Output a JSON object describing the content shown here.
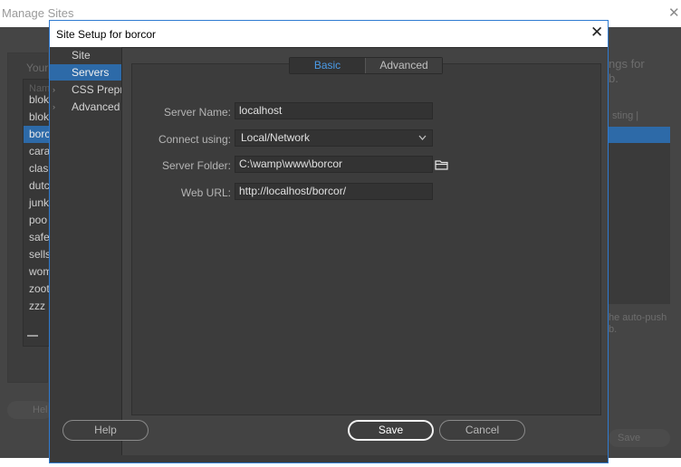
{
  "background_window": {
    "title": "Manage Sites",
    "close_glyph": "✕",
    "your_sites_label": "Your",
    "list_header": "Nam",
    "sites": [
      "blok",
      "blok",
      "borc",
      "cara",
      "clas",
      "dutc",
      "junk",
      "poo",
      "safe",
      "sells",
      "wom",
      "zoot",
      "zzz"
    ],
    "selected_site_index": 2,
    "help_label": "Hel",
    "right_text_1": "ngs for\nb.",
    "right_text_2": "sting  |",
    "right_text_3": "he auto-push\nb.",
    "save_label": "Save"
  },
  "dialog": {
    "title": "Site Setup for borcor",
    "close_glyph": "✕",
    "categories": [
      {
        "label": "Site",
        "has_arrow": false,
        "selected": false
      },
      {
        "label": "Servers",
        "has_arrow": false,
        "selected": true
      },
      {
        "label": "CSS Preprocessors",
        "has_arrow": true,
        "selected": false
      },
      {
        "label": "Advanced Settings",
        "has_arrow": true,
        "selected": false
      }
    ],
    "tabs": [
      {
        "label": "Basic",
        "active": true
      },
      {
        "label": "Advanced",
        "active": false
      }
    ],
    "fields": {
      "server_name": {
        "label": "Server Name:",
        "value": "localhost"
      },
      "connect_using": {
        "label": "Connect using:",
        "value": "Local/Network"
      },
      "server_folder": {
        "label": "Server Folder:",
        "value": "C:\\wamp\\www\\borcor"
      },
      "web_url": {
        "label": "Web URL:",
        "value": "http://localhost/borcor/"
      }
    },
    "buttons": {
      "help": "Help",
      "save": "Save",
      "cancel": "Cancel"
    }
  },
  "colors": {
    "accent": "#2d6aa8",
    "active_tab_text": "#4a9be8",
    "dialog_border": "#2f7bd1"
  },
  "icons": {
    "folder": "folder-icon",
    "chevron": "chevron-down-icon",
    "expand_arrow": "chevron-right-icon"
  }
}
